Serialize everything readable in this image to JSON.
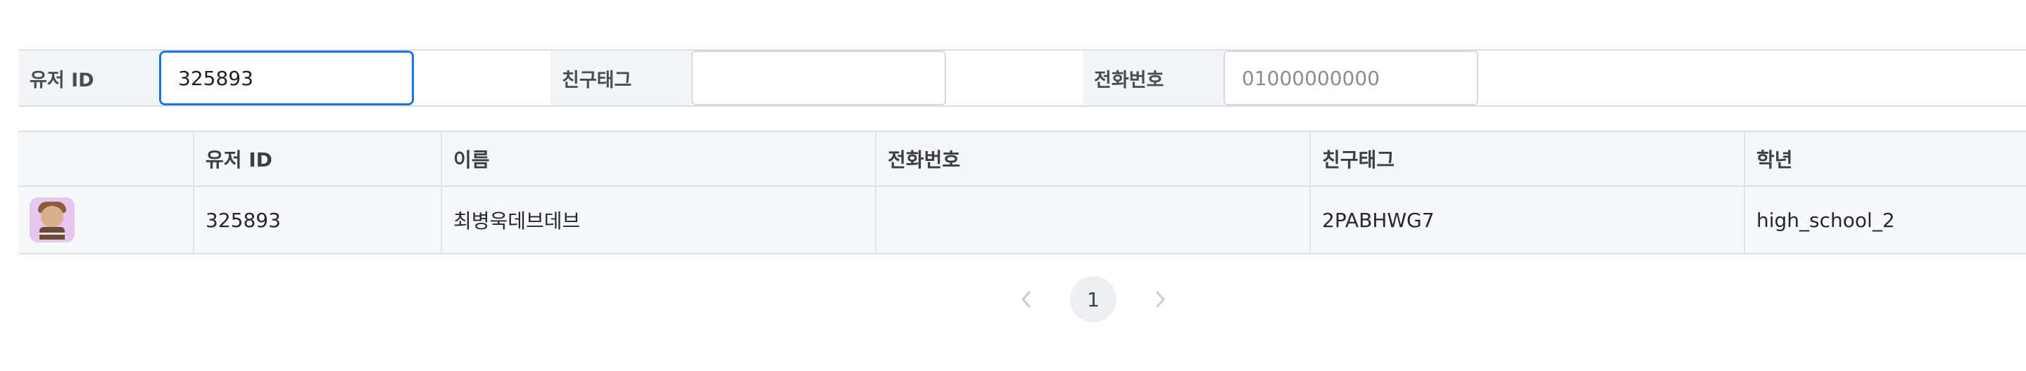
{
  "filters": {
    "user_id": {
      "label": "유저 ID",
      "value": "325893",
      "placeholder": ""
    },
    "friend_tag": {
      "label": "친구태그",
      "value": "",
      "placeholder": ""
    },
    "phone": {
      "label": "전화번호",
      "value": "",
      "placeholder": "01000000000"
    }
  },
  "table": {
    "columns": [
      "",
      "유저 ID",
      "이름",
      "전화번호",
      "친구태그",
      "학년"
    ],
    "rows": [
      {
        "avatar": "user-avatar",
        "user_id": "325893",
        "name": "최병욱데브데브",
        "phone": "",
        "friend_tag": "2PABHWG7",
        "grade": "high_school_2"
      }
    ]
  },
  "pagination": {
    "prev_icon": "chevron-left-icon",
    "current_page": "1",
    "next_icon": "chevron-right-icon"
  },
  "colors": {
    "focus_border": "#1a73e8",
    "header_bg": "#f5f6f8",
    "avatar_bg": "#e7c6ef"
  }
}
